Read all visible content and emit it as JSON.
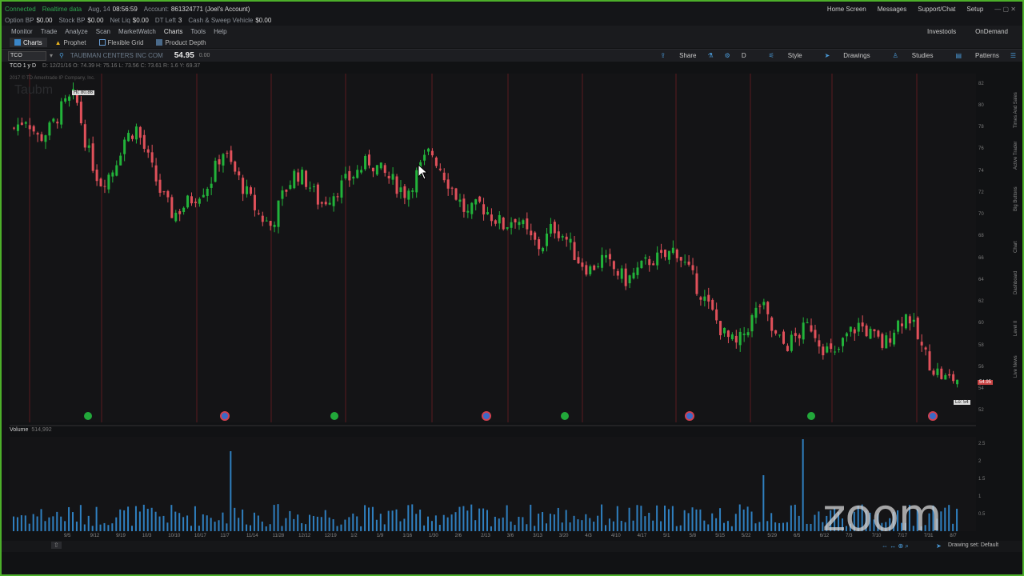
{
  "status": {
    "connection": "Connected",
    "data": "Realtime data",
    "date": "Aug, 14",
    "time": "08:56:59",
    "account_label": "Account:",
    "account": "861324771 (Joel's Account)"
  },
  "top_right": {
    "home": "Home Screen",
    "messages": "Messages",
    "support": "Support/Chat",
    "setup": "Setup"
  },
  "balances": [
    {
      "label": "Option BP",
      "value": "$0.00"
    },
    {
      "label": "Stock BP",
      "value": "$0.00"
    },
    {
      "label": "Net Liq",
      "value": "$0.00"
    },
    {
      "label": "DT Left",
      "value": "3"
    },
    {
      "label": "Cash & Sweep Vehicle",
      "value": "$0.00"
    }
  ],
  "menu": [
    "Monitor",
    "Trade",
    "Analyze",
    "Scan",
    "MarketWatch",
    "Charts",
    "Tools",
    "Help"
  ],
  "menu_active": "Charts",
  "menu_right": {
    "investools": "Investools",
    "ondemand": "OnDemand"
  },
  "subtabs": [
    "Charts",
    "Prophet",
    "Flexible Grid",
    "Product Depth"
  ],
  "toolbar": {
    "symbol": "TCO",
    "company": "TAUBMAN CENTERS INC COM",
    "price": "54.95",
    "change": "0.00",
    "share": "Share",
    "d": "D",
    "style": "Style",
    "drawings": "Drawings",
    "studies": "Studies",
    "patterns": "Patterns"
  },
  "chart_info": {
    "title": "TCO 1 y D",
    "ohlc": "D: 12/21/16   O: 74.39   H: 75.16   L: 73.56   C: 73.61   R: 1.6   Y: 69.37",
    "copyright": "2017 © TD Ameritrade IP Company, Inc.",
    "watermark": "Taubm",
    "hi": "Hi: 80.86",
    "lo": "Lo: 54",
    "last": "54.95"
  },
  "volume": {
    "label": "Volume",
    "value": "514,992"
  },
  "sidebar_tabs": [
    "Times And Sales",
    "Active Trader",
    "Big Buttons",
    "Chart",
    "Dashboard",
    "Level II",
    "Live News"
  ],
  "drawing_set": "Drawing set: Default",
  "zoom_logo": "zoom",
  "colors": {
    "up": "#22b33a",
    "down": "#e0505a",
    "grid": "#2a2b2f",
    "volume": "#2f7fbf",
    "frame": "#4caf2a"
  },
  "chart_data": {
    "type": "candlestick",
    "y_ticks": [
      "82",
      "80",
      "78",
      "76",
      "74",
      "72",
      "70",
      "68",
      "66",
      "64",
      "62",
      "60",
      "58",
      "56",
      "54",
      "52"
    ],
    "volume_ticks": [
      "2.5",
      "2",
      "1.5",
      "1",
      "0.5"
    ],
    "x_ticks": [
      "9/5",
      "9/12",
      "9/19",
      "10/3",
      "10/10",
      "10/17",
      "11/7",
      "11/14",
      "11/28",
      "12/12",
      "12/19",
      "1/2",
      "1/9",
      "1/16",
      "1/30",
      "2/6",
      "2/13",
      "3/6",
      "3/13",
      "3/20",
      "4/3",
      "4/10",
      "4/17",
      "5/1",
      "5/8",
      "5/15",
      "5/22",
      "5/29",
      "6/5",
      "6/12",
      "7/3",
      "7/10",
      "7/17",
      "7/31",
      "8/7"
    ],
    "ylim": [
      51,
      83
    ],
    "close_path": [
      78,
      79,
      77,
      78,
      80,
      81,
      76,
      73,
      74,
      77,
      78,
      75,
      72,
      70,
      71,
      72,
      73,
      76,
      74,
      72,
      70,
      69,
      72,
      74,
      73,
      71,
      72,
      73,
      74,
      75,
      74,
      73,
      72,
      74,
      76,
      74,
      72,
      70,
      71,
      70,
      69,
      70,
      68,
      67,
      69,
      68,
      66,
      65,
      66,
      65,
      64,
      65,
      66,
      66,
      67,
      65,
      63,
      61,
      59,
      58,
      60,
      62,
      59,
      58,
      59,
      60,
      58,
      57,
      59,
      60,
      59,
      58,
      60,
      61,
      58,
      56,
      55,
      55
    ]
  }
}
